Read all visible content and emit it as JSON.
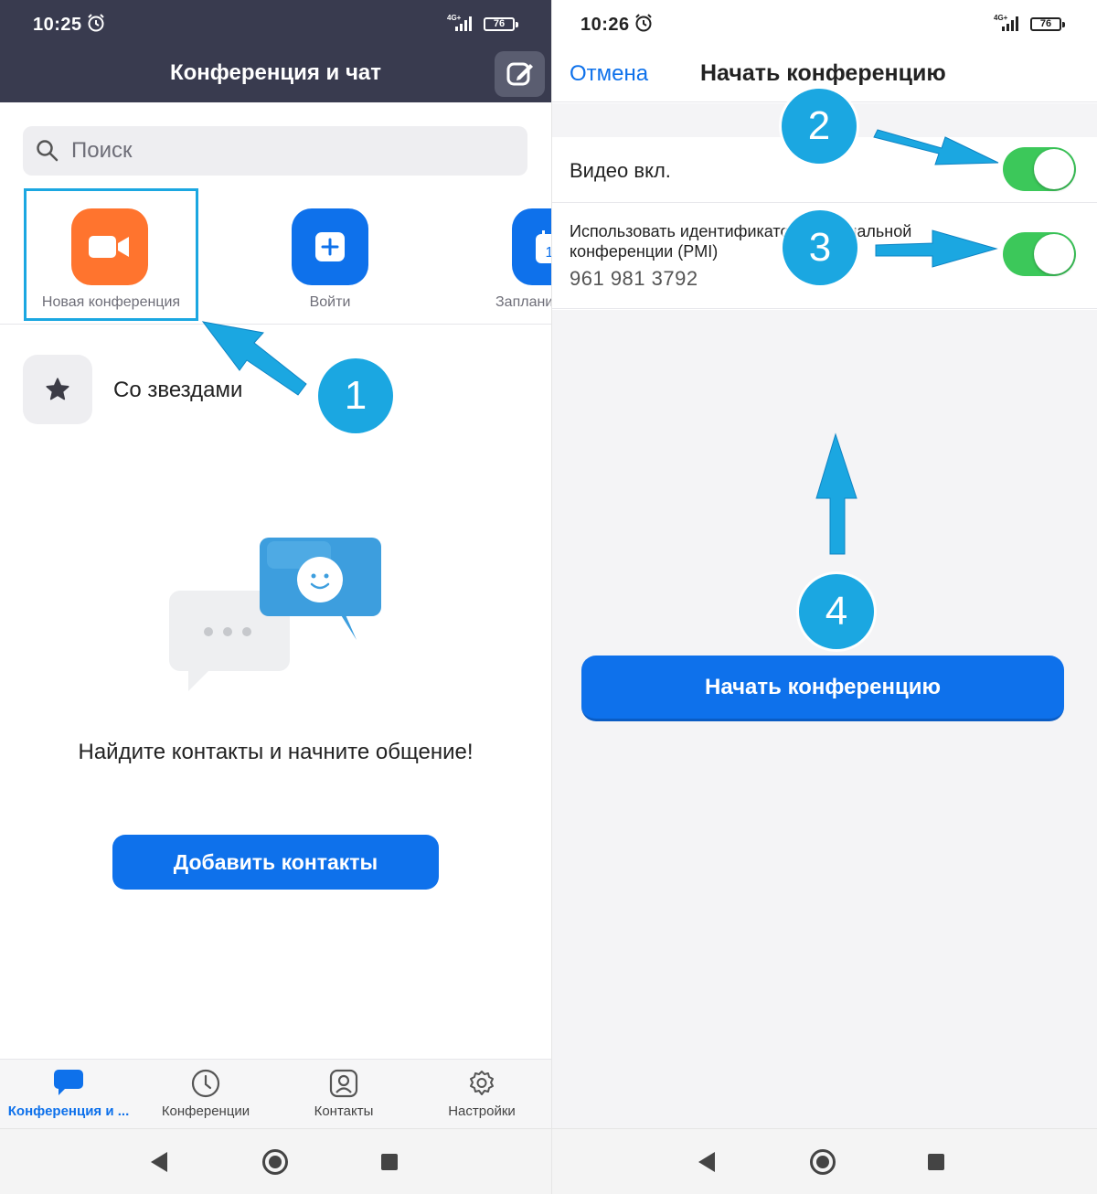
{
  "left": {
    "status": {
      "time": "10:25",
      "network": "4G+",
      "battery": "76"
    },
    "header": {
      "title": "Конференция и чат",
      "compose_icon": "compose-icon"
    },
    "search": {
      "placeholder": "Поиск"
    },
    "actions": [
      {
        "label": "Новая конференция",
        "color": "#ff742e",
        "icon": "video-camera-icon"
      },
      {
        "label": "Войти",
        "color": "#0e71eb",
        "icon": "plus-icon"
      },
      {
        "label": "Запланировать",
        "color": "#0e71eb",
        "icon": "calendar-icon"
      }
    ],
    "starred": {
      "label": "Со звездами",
      "icon": "star-icon"
    },
    "empty_state": {
      "message": "Найдите контакты и начните общение!"
    },
    "add_contacts_button": "Добавить контакты",
    "tabs": [
      {
        "label": "Конференция и ...",
        "icon": "chat-bubble-icon",
        "active": true
      },
      {
        "label": "Конференции",
        "icon": "clock-icon",
        "active": false
      },
      {
        "label": "Контакты",
        "icon": "contact-icon",
        "active": false
      },
      {
        "label": "Настройки",
        "icon": "gear-icon",
        "active": false
      }
    ]
  },
  "right": {
    "status": {
      "time": "10:26",
      "network": "4G+",
      "battery": "76"
    },
    "header": {
      "cancel": "Отмена",
      "title": "Начать конференцию"
    },
    "video_option": {
      "label": "Видео вкл.",
      "enabled": true
    },
    "pmi_option": {
      "label": "Использовать идентификатор персональной конференции (PMI)",
      "value": "961 981 3792",
      "enabled": true
    },
    "start_button": "Начать конференцию"
  },
  "annotations": {
    "step_1": "1",
    "step_2": "2",
    "step_3": "3",
    "step_4": "4"
  },
  "colors": {
    "accent": "#0e71eb",
    "annotation": "#1ba7e1",
    "header_bg": "#393b4f",
    "toggle_on": "#3cc85a",
    "new_meeting": "#ff742e"
  }
}
